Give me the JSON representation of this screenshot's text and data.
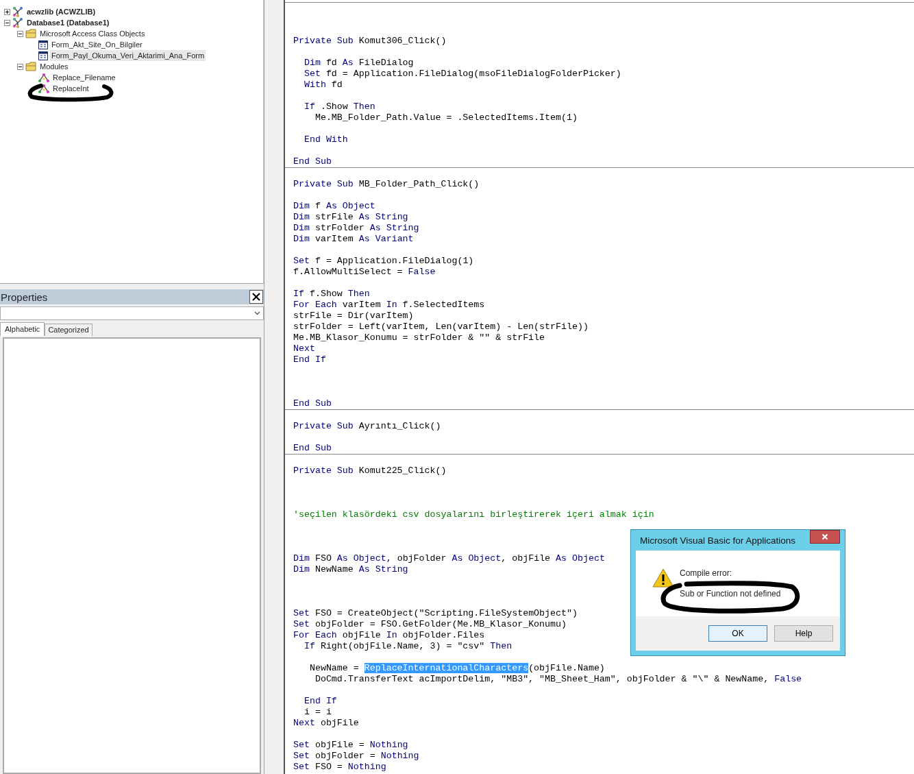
{
  "project_explorer": {
    "tree": [
      {
        "label": "acwzlib (ACWZLIB)",
        "kind": "project",
        "expanded": false,
        "selected": false
      },
      {
        "label": "Database1 (Database1)",
        "kind": "project",
        "expanded": true,
        "selected": false,
        "children": [
          {
            "label": "Microsoft Access Class Objects",
            "kind": "folder",
            "expanded": true,
            "selected": false,
            "children": [
              {
                "label": "Form_Akt_Site_On_Bilgiler",
                "kind": "form",
                "selected": false
              },
              {
                "label": "Form_Payl_Okuma_Veri_Aktarimi_Ana_Form",
                "kind": "form",
                "selected": true
              }
            ]
          },
          {
            "label": "Modules",
            "kind": "folder",
            "expanded": true,
            "selected": false,
            "children": [
              {
                "label": "Replace_Filename",
                "kind": "module",
                "selected": false
              },
              {
                "label": "ReplaceInt",
                "kind": "module",
                "selected": false
              }
            ]
          }
        ]
      }
    ]
  },
  "properties": {
    "title": "Properties",
    "tabs": [
      {
        "label": "Alphabetic",
        "selected": true
      },
      {
        "label": "Categorized",
        "selected": false
      }
    ]
  },
  "code": {
    "procedures": [
      {
        "lines": [
          {
            "kind": "blank"
          },
          {
            "kind": "blank"
          },
          {
            "kind": "blank"
          },
          {
            "kind": "code",
            "tokens": [
              {
                "text": "Private Sub",
                "kind": "keyword"
              },
              {
                "text": " Komut306_Click()",
                "kind": "plain"
              }
            ]
          },
          {
            "kind": "blank"
          },
          {
            "kind": "code",
            "tokens": [
              {
                "text": "  Dim",
                "kind": "keyword"
              },
              {
                "text": " fd ",
                "kind": "plain"
              },
              {
                "text": "As",
                "kind": "keyword"
              },
              {
                "text": " FileDialog",
                "kind": "plain"
              }
            ]
          },
          {
            "kind": "code",
            "tokens": [
              {
                "text": "  Set",
                "kind": "keyword"
              },
              {
                "text": " fd = Application.FileDialog(msoFileDialogFolderPicker)",
                "kind": "plain"
              }
            ]
          },
          {
            "kind": "code",
            "tokens": [
              {
                "text": "  With",
                "kind": "keyword"
              },
              {
                "text": " fd",
                "kind": "plain"
              }
            ]
          },
          {
            "kind": "blank"
          },
          {
            "kind": "code",
            "tokens": [
              {
                "text": "  If",
                "kind": "keyword"
              },
              {
                "text": " .Show ",
                "kind": "plain"
              },
              {
                "text": "Then",
                "kind": "keyword"
              }
            ]
          },
          {
            "kind": "code",
            "tokens": [
              {
                "text": "    Me.MB_Folder_Path.Value = .SelectedItems.Item(1)",
                "kind": "plain"
              }
            ]
          },
          {
            "kind": "blank"
          },
          {
            "kind": "code",
            "tokens": [
              {
                "text": "  End With",
                "kind": "keyword"
              }
            ]
          },
          {
            "kind": "blank"
          },
          {
            "kind": "code",
            "tokens": [
              {
                "text": "End Sub",
                "kind": "keyword"
              }
            ]
          }
        ]
      },
      {
        "lines": [
          {
            "kind": "blank"
          },
          {
            "kind": "code",
            "tokens": [
              {
                "text": "Private Sub",
                "kind": "keyword"
              },
              {
                "text": " MB_Folder_Path_Click()",
                "kind": "plain"
              }
            ]
          },
          {
            "kind": "blank"
          },
          {
            "kind": "code",
            "tokens": [
              {
                "text": "Dim",
                "kind": "keyword"
              },
              {
                "text": " f ",
                "kind": "plain"
              },
              {
                "text": "As Object",
                "kind": "keyword"
              }
            ]
          },
          {
            "kind": "code",
            "tokens": [
              {
                "text": "Dim",
                "kind": "keyword"
              },
              {
                "text": " strFile ",
                "kind": "plain"
              },
              {
                "text": "As String",
                "kind": "keyword"
              }
            ]
          },
          {
            "kind": "code",
            "tokens": [
              {
                "text": "Dim",
                "kind": "keyword"
              },
              {
                "text": " strFolder ",
                "kind": "plain"
              },
              {
                "text": "As String",
                "kind": "keyword"
              }
            ]
          },
          {
            "kind": "code",
            "tokens": [
              {
                "text": "Dim",
                "kind": "keyword"
              },
              {
                "text": " varItem ",
                "kind": "plain"
              },
              {
                "text": "As Variant",
                "kind": "keyword"
              }
            ]
          },
          {
            "kind": "blank"
          },
          {
            "kind": "code",
            "tokens": [
              {
                "text": "Set",
                "kind": "keyword"
              },
              {
                "text": " f = Application.FileDialog(1)",
                "kind": "plain"
              }
            ]
          },
          {
            "kind": "code",
            "tokens": [
              {
                "text": "f.AllowMultiSelect = ",
                "kind": "plain"
              },
              {
                "text": "False",
                "kind": "keyword"
              }
            ]
          },
          {
            "kind": "blank"
          },
          {
            "kind": "code",
            "tokens": [
              {
                "text": "If",
                "kind": "keyword"
              },
              {
                "text": " f.Show ",
                "kind": "plain"
              },
              {
                "text": "Then",
                "kind": "keyword"
              }
            ]
          },
          {
            "kind": "code",
            "tokens": [
              {
                "text": "For Each",
                "kind": "keyword"
              },
              {
                "text": " varItem ",
                "kind": "plain"
              },
              {
                "text": "In",
                "kind": "keyword"
              },
              {
                "text": " f.SelectedItems",
                "kind": "plain"
              }
            ]
          },
          {
            "kind": "code",
            "tokens": [
              {
                "text": "strFile = Dir(varItem)",
                "kind": "plain"
              }
            ]
          },
          {
            "kind": "code",
            "tokens": [
              {
                "text": "strFolder = Left(varItem, Len(varItem) - Len(strFile))",
                "kind": "plain"
              }
            ]
          },
          {
            "kind": "code",
            "tokens": [
              {
                "text": "Me.MB_Klasor_Konumu = strFolder & \"\" & strFile",
                "kind": "plain"
              }
            ]
          },
          {
            "kind": "code",
            "tokens": [
              {
                "text": "Next",
                "kind": "keyword"
              }
            ]
          },
          {
            "kind": "code",
            "tokens": [
              {
                "text": "End If",
                "kind": "keyword"
              }
            ]
          },
          {
            "kind": "blank"
          },
          {
            "kind": "blank"
          },
          {
            "kind": "blank"
          },
          {
            "kind": "code",
            "tokens": [
              {
                "text": "End Sub",
                "kind": "keyword"
              }
            ]
          }
        ]
      },
      {
        "lines": [
          {
            "kind": "blank"
          },
          {
            "kind": "code",
            "tokens": [
              {
                "text": "Private Sub",
                "kind": "keyword"
              },
              {
                "text": " Ayrıntı_Click()",
                "kind": "plain"
              }
            ]
          },
          {
            "kind": "blank"
          },
          {
            "kind": "code",
            "tokens": [
              {
                "text": "End Sub",
                "kind": "keyword"
              }
            ]
          }
        ]
      },
      {
        "lines": [
          {
            "kind": "blank"
          },
          {
            "kind": "code",
            "tokens": [
              {
                "text": "Private Sub",
                "kind": "keyword"
              },
              {
                "text": " Komut225_Click()",
                "kind": "plain"
              }
            ]
          },
          {
            "kind": "blank"
          },
          {
            "kind": "blank"
          },
          {
            "kind": "blank"
          },
          {
            "kind": "code",
            "tokens": [
              {
                "text": "'seçilen klasördeki csv dosyalarını birleştirerek içeri almak için",
                "kind": "comment"
              }
            ]
          },
          {
            "kind": "blank"
          },
          {
            "kind": "blank"
          },
          {
            "kind": "blank"
          },
          {
            "kind": "code",
            "tokens": [
              {
                "text": "Dim",
                "kind": "keyword"
              },
              {
                "text": " FSO ",
                "kind": "plain"
              },
              {
                "text": "As Object",
                "kind": "keyword"
              },
              {
                "text": ", objFolder ",
                "kind": "plain"
              },
              {
                "text": "As Object",
                "kind": "keyword"
              },
              {
                "text": ", objFile ",
                "kind": "plain"
              },
              {
                "text": "As Object",
                "kind": "keyword"
              }
            ]
          },
          {
            "kind": "code",
            "tokens": [
              {
                "text": "Dim",
                "kind": "keyword"
              },
              {
                "text": " NewName ",
                "kind": "plain"
              },
              {
                "text": "As String",
                "kind": "keyword"
              }
            ]
          },
          {
            "kind": "blank"
          },
          {
            "kind": "blank"
          },
          {
            "kind": "blank"
          },
          {
            "kind": "code",
            "tokens": [
              {
                "text": "Set",
                "kind": "keyword"
              },
              {
                "text": " FSO = CreateObject(\"Scripting.FileSystemObject\")",
                "kind": "plain"
              }
            ]
          },
          {
            "kind": "code",
            "tokens": [
              {
                "text": "Set",
                "kind": "keyword"
              },
              {
                "text": " objFolder = FSO.GetFolder(Me.MB_Klasor_Konumu)",
                "kind": "plain"
              }
            ]
          },
          {
            "kind": "code",
            "tokens": [
              {
                "text": "For Each",
                "kind": "keyword"
              },
              {
                "text": " objFile ",
                "kind": "plain"
              },
              {
                "text": "In",
                "kind": "keyword"
              },
              {
                "text": " objFolder.Files",
                "kind": "plain"
              }
            ]
          },
          {
            "kind": "code",
            "tokens": [
              {
                "text": "  If",
                "kind": "keyword"
              },
              {
                "text": " Right(objFile.Name, 3) = \"csv\" ",
                "kind": "plain"
              },
              {
                "text": "Then",
                "kind": "keyword"
              }
            ]
          },
          {
            "kind": "blank"
          },
          {
            "kind": "code",
            "tokens": [
              {
                "text": "   NewName = ",
                "kind": "plain"
              },
              {
                "text": "ReplaceInternationalCharacters",
                "kind": "selection"
              },
              {
                "text": "(objFile.Name)",
                "kind": "plain"
              }
            ]
          },
          {
            "kind": "code",
            "tokens": [
              {
                "text": "    DoCmd.TransferText acImportDelim, \"MB3\", \"MB_Sheet_Ham\", objFolder & \"\\\" & NewName, ",
                "kind": "plain"
              },
              {
                "text": "False",
                "kind": "keyword"
              }
            ]
          },
          {
            "kind": "blank"
          },
          {
            "kind": "code",
            "tokens": [
              {
                "text": "  End If",
                "kind": "keyword"
              }
            ]
          },
          {
            "kind": "code",
            "tokens": [
              {
                "text": "  i = i",
                "kind": "plain"
              }
            ]
          },
          {
            "kind": "code",
            "tokens": [
              {
                "text": "Next",
                "kind": "keyword"
              },
              {
                "text": " objFile",
                "kind": "plain"
              }
            ]
          },
          {
            "kind": "blank"
          },
          {
            "kind": "code",
            "tokens": [
              {
                "text": "Set",
                "kind": "keyword"
              },
              {
                "text": " objFile = ",
                "kind": "plain"
              },
              {
                "text": "Nothing",
                "kind": "keyword"
              }
            ]
          },
          {
            "kind": "code",
            "tokens": [
              {
                "text": "Set",
                "kind": "keyword"
              },
              {
                "text": " objFolder = ",
                "kind": "plain"
              },
              {
                "text": "Nothing",
                "kind": "keyword"
              }
            ]
          },
          {
            "kind": "code",
            "tokens": [
              {
                "text": "Set",
                "kind": "keyword"
              },
              {
                "text": " FSO = ",
                "kind": "plain"
              },
              {
                "text": "Nothing",
                "kind": "keyword"
              }
            ]
          }
        ]
      }
    ]
  },
  "dialog": {
    "title": "Microsoft Visual Basic for Applications",
    "heading": "Compile error:",
    "message": "Sub or Function not defined",
    "buttons": [
      {
        "label": "OK",
        "focused": true
      },
      {
        "label": "Help",
        "focused": false
      }
    ]
  }
}
